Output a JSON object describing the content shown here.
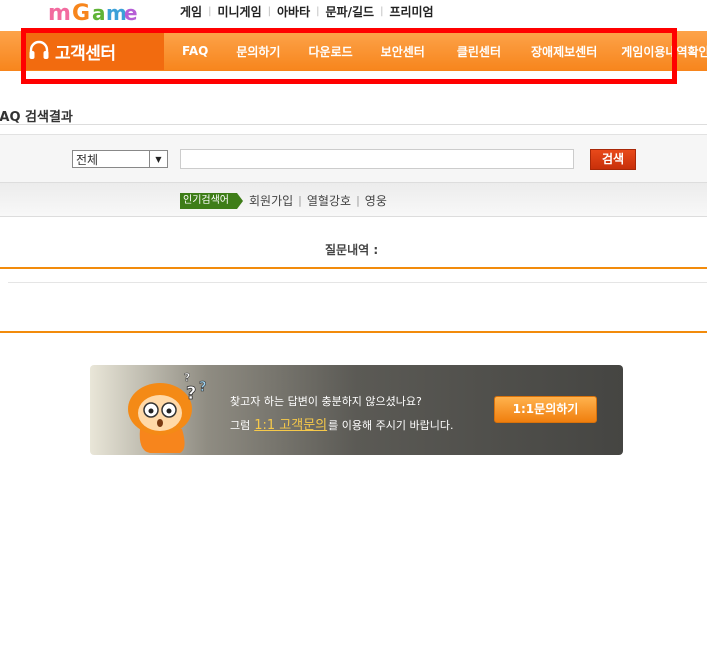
{
  "logo": {
    "text": "mGame"
  },
  "top_nav": [
    "게임",
    "미니게임",
    "아바타",
    "문파/길드",
    "프리미엄"
  ],
  "brand": {
    "label": "고객센터"
  },
  "main_nav": [
    "FAQ",
    "문의하기",
    "다운로드",
    "보안센터",
    "클린센터",
    "장애제보센터",
    "게임이용내역확인"
  ],
  "section_title": "FAQ 검색결과",
  "search": {
    "category_selected": "전체",
    "query_value": "",
    "button_label": "검색"
  },
  "popular": {
    "badge": "인기검색어",
    "keywords": [
      "회원가입",
      "열혈강호",
      "영웅"
    ]
  },
  "question_history": {
    "label": "질문내역 :"
  },
  "banner": {
    "line1": "찾고자 하는 답변이 충분하지 않으셨나요?",
    "line2_prefix": "그럼",
    "line2_highlight": "1:1 고객문의",
    "line2_suffix": "를 이용해 주시기 바랍니다.",
    "button_label": "1:1문의하기"
  },
  "colors": {
    "nav_orange": "#f7851c",
    "brand_orange": "#f26b0f",
    "highlight_red": "#ff0000",
    "search_button": "#d73a10",
    "popular_green": "#3e7d18"
  }
}
